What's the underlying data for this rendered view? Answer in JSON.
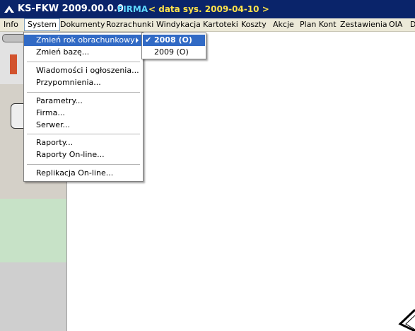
{
  "title_bar": {
    "app_title": "KS-FKW 2009.00.0.0",
    "firma": "FIRMA",
    "date_info": "< data sys. 2009-04-10 >"
  },
  "menu_bar": {
    "items": [
      "Info",
      "System",
      "Dokumenty",
      "Rozrachunki",
      "Windykacja",
      "Kartoteki",
      "Koszty",
      "Akcje",
      "Plan Kont",
      "Zestawienia",
      "OIA",
      "D"
    ]
  },
  "system_menu": {
    "items": [
      "Zmień rok obrachunkowy",
      "Zmień bazę...",
      "Wiadomości i ogłoszenia...",
      "Przypomnienia...",
      "Parametry...",
      "Firma...",
      "Serwer...",
      "Raporty...",
      "Raporty On-line...",
      "Replikacja On-line..."
    ]
  },
  "year_submenu": {
    "items": [
      "2008 (O)",
      "2009 (O)"
    ],
    "checked": "2008 (O)"
  },
  "colors": {
    "title_bar": "#0a246a",
    "highlight": "#316ac5",
    "firma": "#5fd8ff",
    "date": "#ffe34a",
    "green_panel": "#c7e2c7"
  },
  "icons": [
    "app-logo-icon",
    "submenu-arrow-icon",
    "check-icon"
  ]
}
